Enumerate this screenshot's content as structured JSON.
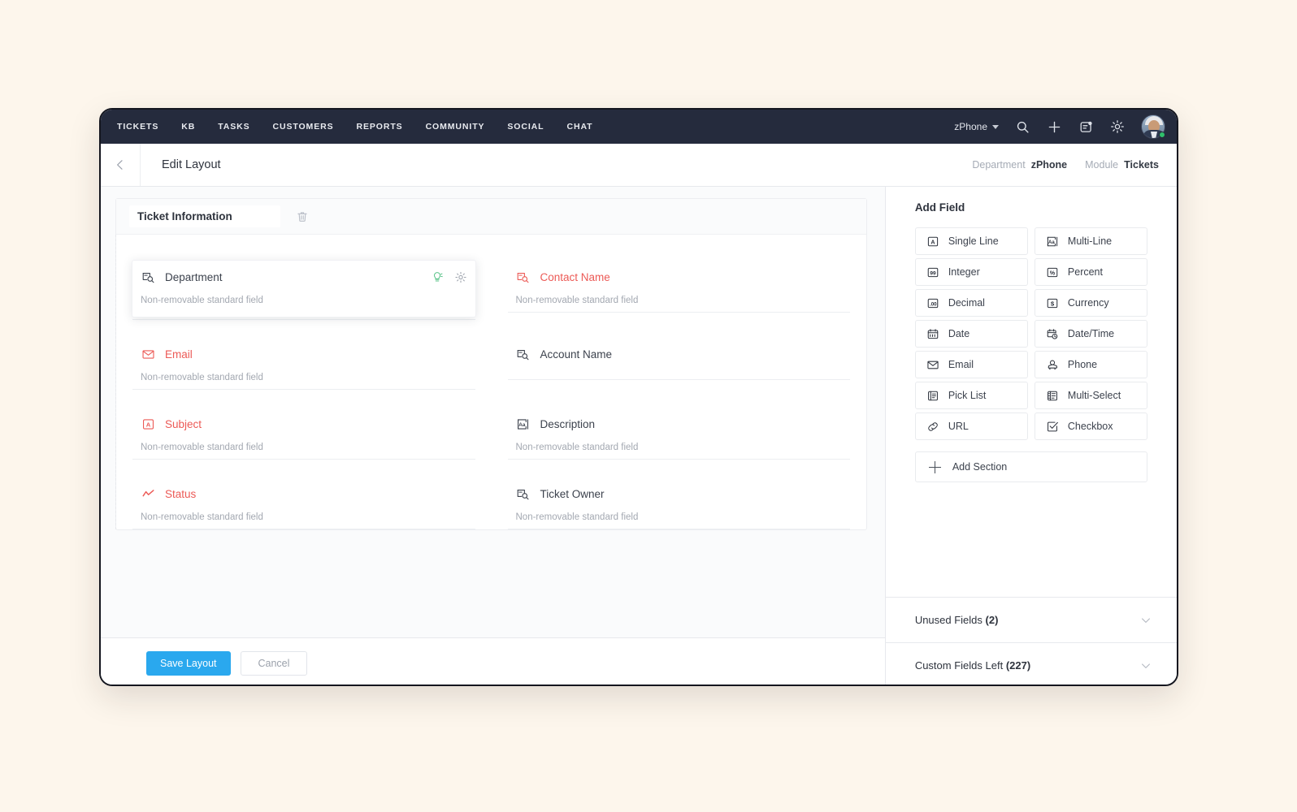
{
  "topnav": {
    "links": [
      "TICKETS",
      "KB",
      "TASKS",
      "CUSTOMERS",
      "REPORTS",
      "COMMUNITY",
      "SOCIAL",
      "CHAT"
    ],
    "department_switcher": "zPhone",
    "icons": [
      "search-icon",
      "plus-icon",
      "notes-icon",
      "gear-icon"
    ],
    "avatar_label": "user-avatar",
    "presence": "online"
  },
  "subheader": {
    "back": "back-icon",
    "title": "Edit Layout",
    "breadcrumb": {
      "department_label": "Department",
      "department_value": "zPhone",
      "module_label": "Module",
      "module_value": "Tickets"
    }
  },
  "section": {
    "name": "Ticket Information",
    "delete_icon": "trash-icon"
  },
  "fields": [
    {
      "name": "Department",
      "icon": "lookup-icon",
      "sub": "Non-removable standard field",
      "required": false,
      "hovered": true,
      "actions": [
        "bulb-icon",
        "gear-icon"
      ]
    },
    {
      "name": "Contact Name",
      "icon": "lookup-icon",
      "sub": "Non-removable standard field",
      "required": true,
      "hovered": false,
      "actions": []
    },
    {
      "name": "Email",
      "icon": "email-icon",
      "sub": "Non-removable standard field",
      "required": true,
      "hovered": false,
      "actions": []
    },
    {
      "name": "Account Name",
      "icon": "lookup-icon",
      "sub": "",
      "required": false,
      "hovered": false,
      "actions": []
    },
    {
      "name": "Subject",
      "icon": "single-line-icon",
      "sub": "Non-removable standard field",
      "required": true,
      "hovered": false,
      "actions": []
    },
    {
      "name": "Description",
      "icon": "multi-line-icon",
      "sub": "Non-removable standard field",
      "required": false,
      "hovered": false,
      "actions": []
    },
    {
      "name": "Status",
      "icon": "status-icon",
      "sub": "Non-removable standard field",
      "required": true,
      "hovered": false,
      "actions": []
    },
    {
      "name": "Ticket Owner",
      "icon": "lookup-icon",
      "sub": "Non-removable standard field",
      "required": false,
      "hovered": false,
      "actions": []
    }
  ],
  "actionbar": {
    "save_label": "Save Layout",
    "cancel_label": "Cancel"
  },
  "sidepanel": {
    "title": "Add Field",
    "field_types": [
      {
        "label": "Single Line",
        "icon": "single-line-icon"
      },
      {
        "label": "Multi-Line",
        "icon": "multi-line-icon"
      },
      {
        "label": "Integer",
        "icon": "integer-icon"
      },
      {
        "label": "Percent",
        "icon": "percent-icon"
      },
      {
        "label": "Decimal",
        "icon": "decimal-icon"
      },
      {
        "label": "Currency",
        "icon": "currency-icon"
      },
      {
        "label": "Date",
        "icon": "date-icon"
      },
      {
        "label": "Date/Time",
        "icon": "datetime-icon"
      },
      {
        "label": "Email",
        "icon": "email-icon"
      },
      {
        "label": "Phone",
        "icon": "phone-icon"
      },
      {
        "label": "Pick List",
        "icon": "picklist-icon"
      },
      {
        "label": "Multi-Select",
        "icon": "multiselect-icon"
      },
      {
        "label": "URL",
        "icon": "url-icon"
      },
      {
        "label": "Checkbox",
        "icon": "checkbox-icon"
      }
    ],
    "add_section_label": "Add Section",
    "accordions": [
      {
        "label": "Unused Fields",
        "count": "(2)"
      },
      {
        "label": "Custom Fields Left",
        "count": "(227)"
      }
    ]
  },
  "colors": {
    "accent_blue": "#2aa8ee",
    "required_red": "#ec5a56",
    "nav_dark": "#252b3d",
    "page_bg": "#fdf6ec",
    "status_green": "#2fc06b"
  }
}
